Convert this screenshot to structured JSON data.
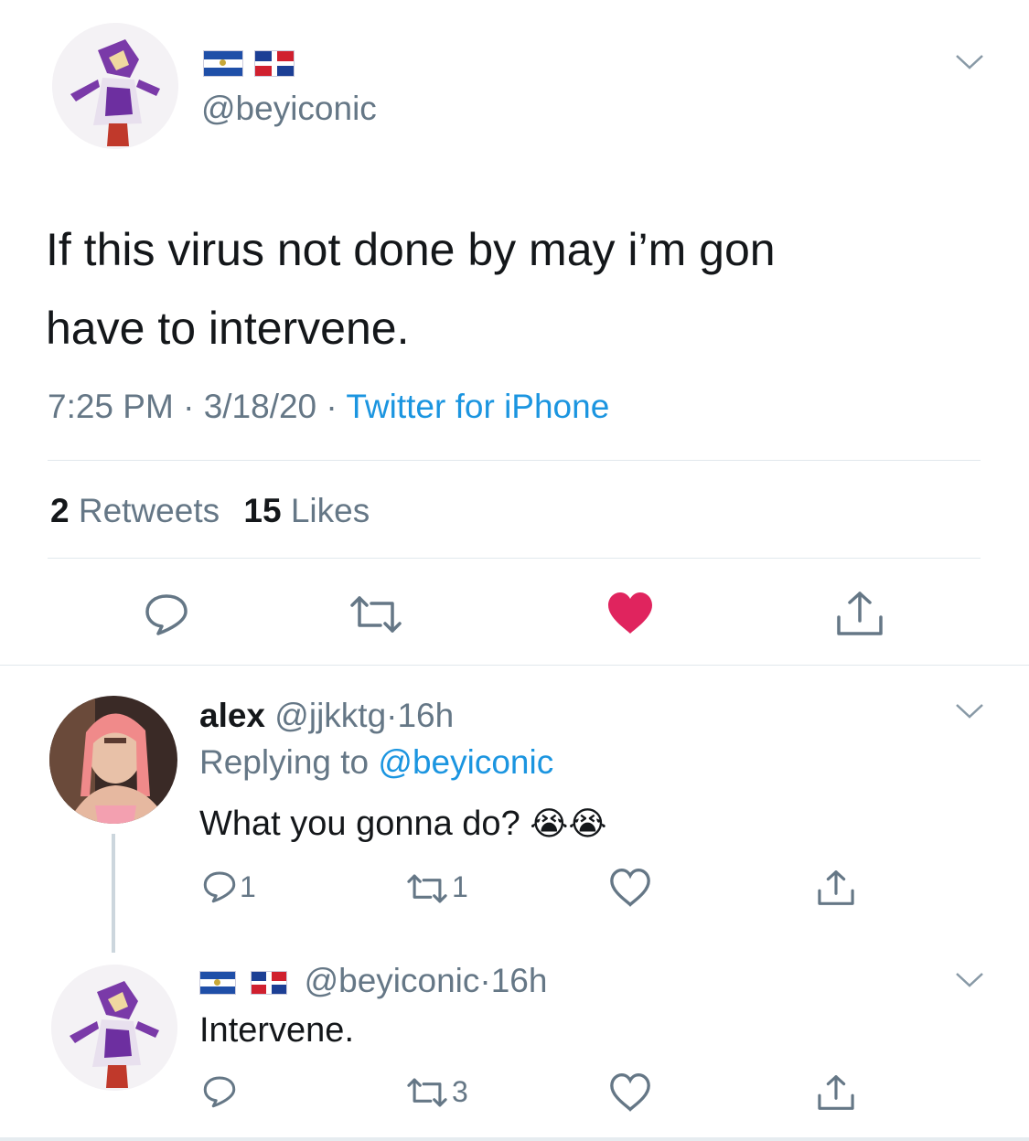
{
  "main_tweet": {
    "handle": "@beyiconic",
    "text_line1": "If this virus not done by may i’m gon",
    "text_line2": "have to intervene.",
    "time": "7:25 PM",
    "date": "3/18/20",
    "source": "Twitter for iPhone",
    "sep": "·",
    "retweets_count": "2",
    "retweets_label": "Retweets",
    "likes_count": "15",
    "likes_label": "Likes",
    "liked": true
  },
  "reply1": {
    "name": "alex",
    "handle": "@jjkktg",
    "time": "16h",
    "sep": "·",
    "replying_prefix": "Replying to",
    "replying_handle": "@beyiconic",
    "text": "What you gonna do?",
    "emoji": "😭😭",
    "reply_count": "1",
    "retweet_count": "1"
  },
  "reply2": {
    "handle": "@beyiconic",
    "time": "16h",
    "sep": "·",
    "text": "Intervene.",
    "retweet_count": "3"
  },
  "colors": {
    "like_red": "#e0245e",
    "link_blue": "#1b95e0",
    "gray": "#657786"
  },
  "icons": [
    "chevron-down-icon",
    "reply-icon",
    "retweet-icon",
    "heart-icon",
    "share-icon",
    "el-salvador-flag-icon",
    "dominican-flag-icon"
  ]
}
